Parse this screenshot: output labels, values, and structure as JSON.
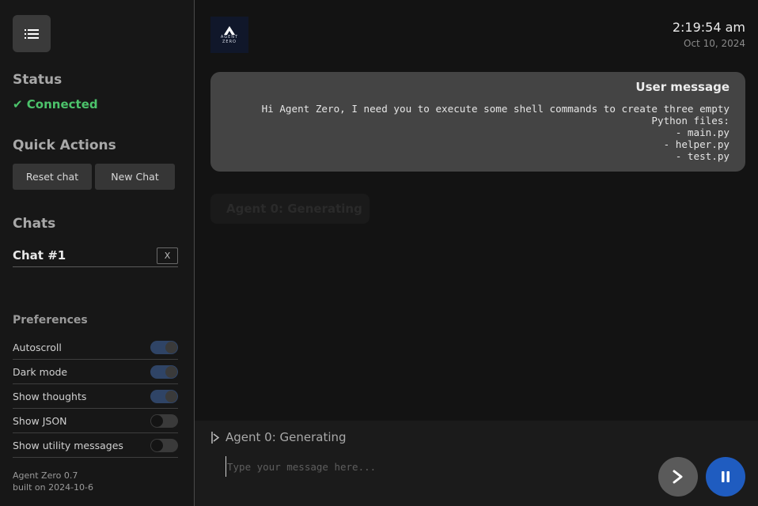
{
  "sidebar": {
    "status_title": "Status",
    "status_value": "✔ Connected",
    "quick_actions_title": "Quick Actions",
    "reset_chat_label": "Reset chat",
    "new_chat_label": "New Chat",
    "chats_title": "Chats",
    "chats": [
      {
        "name": "Chat #1",
        "close_label": "X"
      }
    ],
    "preferences_title": "Preferences",
    "preferences": [
      {
        "label": "Autoscroll",
        "enabled": true
      },
      {
        "label": "Dark mode",
        "enabled": true
      },
      {
        "label": "Show thoughts",
        "enabled": true
      },
      {
        "label": "Show JSON",
        "enabled": false
      },
      {
        "label": "Show utility messages",
        "enabled": false
      }
    ],
    "version": "Agent Zero 0.7",
    "build": "built on 2024-10-6"
  },
  "header": {
    "logo_line1": "AGENT",
    "logo_line2": "ZERO",
    "time": "2:19:54 am",
    "date": "Oct 10, 2024"
  },
  "messages": [
    {
      "title": "User message",
      "body": "Hi Agent Zero, I need you to execute some shell commands to create three empty\nPython files:\n- main.py\n- helper.py\n- test.py"
    }
  ],
  "ghost_status": "Agent 0: Generating",
  "footer": {
    "progress_text": "Agent 0: Generating",
    "input_placeholder": "Type your message here...",
    "input_value": ""
  },
  "colors": {
    "connected": "#4cc36b",
    "pause_button": "#1f5cc0",
    "send_button": "#5a5a5a"
  }
}
